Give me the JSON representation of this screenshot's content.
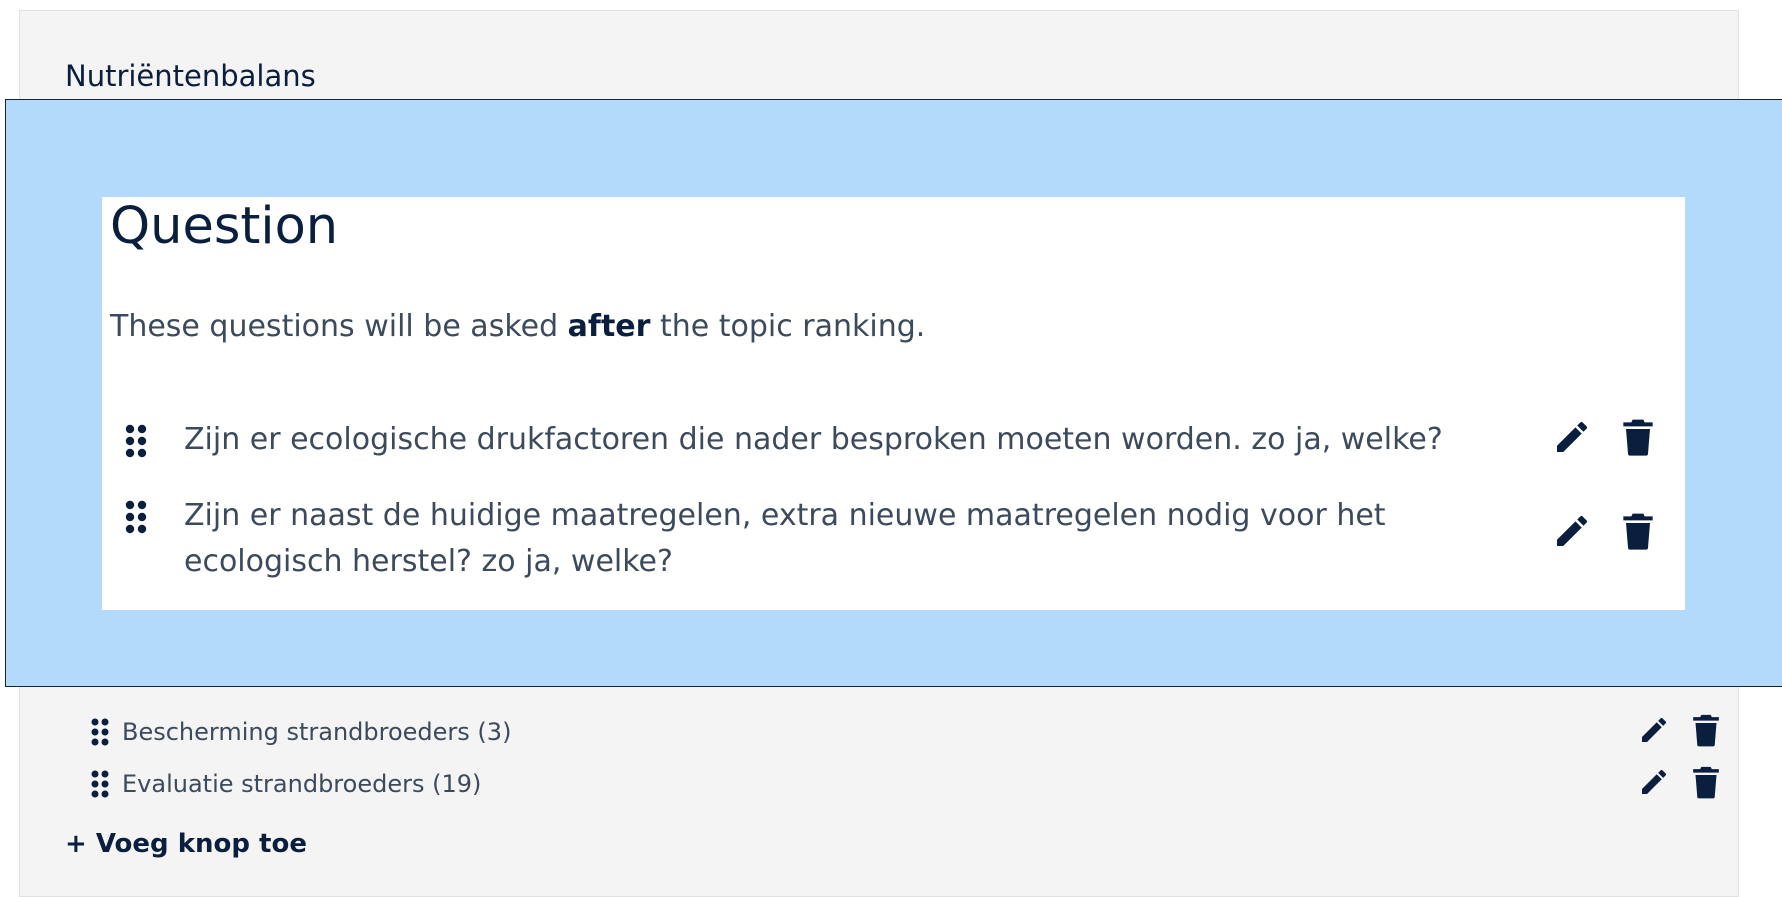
{
  "panel": {
    "title": "Nutriëntenbalans",
    "topics": [
      {
        "label": "Bescherming strandbroeders (3)"
      },
      {
        "label": "Evaluatie strandbroeders (19)"
      }
    ],
    "add_button_label": "+ Voeg knop toe"
  },
  "overlay": {
    "title": "Question",
    "intro_before": "These questions will be asked ",
    "intro_bold": "after",
    "intro_after": " the topic ranking.",
    "questions": [
      {
        "text": "Zijn er ecologische drukfactoren die nader besproken moeten worden. zo ja, welke?"
      },
      {
        "text": "Zijn er naast de huidige maatregelen, extra nieuwe maatregelen nodig voor het ecologisch herstel? zo ja, welke?"
      }
    ]
  },
  "colors": {
    "overlay_bg": "#b3dafa",
    "panel_bg": "#f4f4f4",
    "ink": "#0a1f3d",
    "text": "#3c4a5c"
  },
  "icons": [
    "drag-handle-icon",
    "pencil-icon",
    "trash-icon"
  ]
}
